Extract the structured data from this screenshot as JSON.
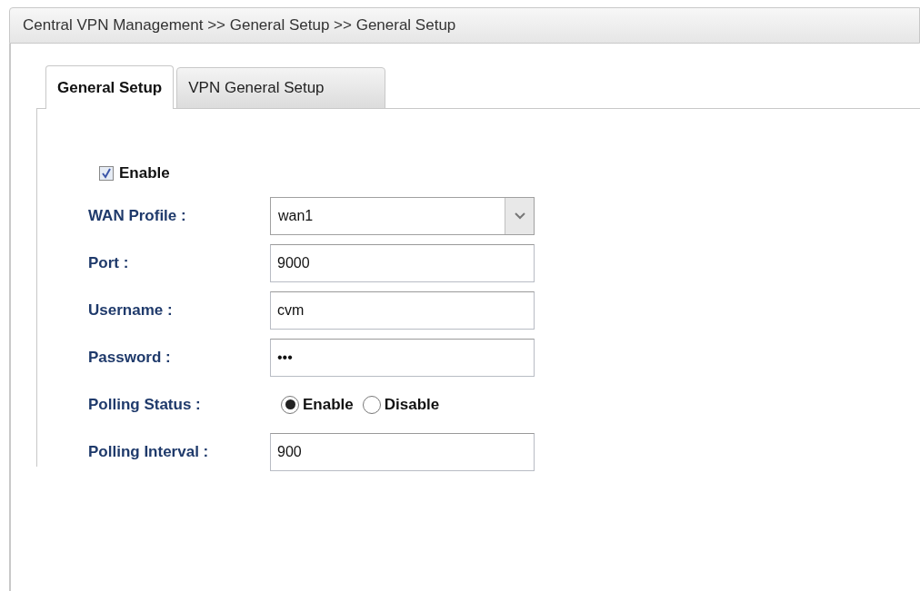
{
  "breadcrumb": "Central VPN Management >> General Setup >> General Setup",
  "tabs": [
    {
      "label": "General Setup",
      "selected": true
    },
    {
      "label": "VPN General Setup",
      "selected": false
    }
  ],
  "enable": {
    "label": "Enable",
    "checked": true
  },
  "fields": [
    {
      "kind": "select",
      "label": "WAN Profile :",
      "value": "wan1"
    },
    {
      "kind": "text",
      "label": "Port :",
      "value": "9000"
    },
    {
      "kind": "text",
      "label": "Username :",
      "value": "cvm"
    },
    {
      "kind": "text",
      "label": "Password :",
      "value": "•••"
    },
    {
      "kind": "radio",
      "label": "Polling Status :",
      "options": [
        {
          "label": "Enable",
          "selected": true
        },
        {
          "label": "Disable",
          "selected": false
        }
      ]
    },
    {
      "kind": "text",
      "label": "Polling Interval :",
      "value": "900"
    }
  ]
}
